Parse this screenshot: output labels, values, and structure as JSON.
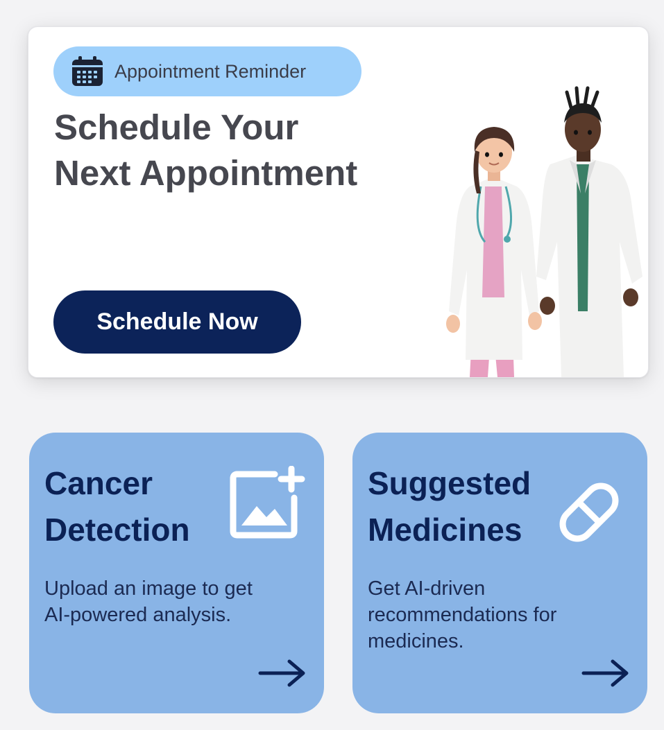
{
  "banner": {
    "pill_icon": "calendar-icon",
    "pill_label": "Appointment Reminder",
    "title_line1": "Schedule Your",
    "title_line2": "Next Appointment",
    "button_label": "Schedule Now",
    "illustration": "doctors-illustration"
  },
  "cards": [
    {
      "title_line1": "Cancer",
      "title_line2": "Detection",
      "icon": "add-image-icon",
      "desc_line1": "Upload an image to get",
      "desc_line2": "AI-powered analysis.",
      "arrow_icon": "arrow-right-icon"
    },
    {
      "title_line1": "Suggested",
      "title_line2": "Medicines",
      "icon": "pill-icon",
      "desc_line1": "Get AI-driven",
      "desc_line2": "recommendations for",
      "desc_line3": "medicines.",
      "arrow_icon": "arrow-right-icon"
    }
  ],
  "colors": {
    "page_bg": "#f3f3f5",
    "pill_bg": "#9ed0fb",
    "button_bg": "#0c2359",
    "card_bg": "#89b4e6",
    "card_title": "#0b2155",
    "banner_title": "#46474f"
  }
}
